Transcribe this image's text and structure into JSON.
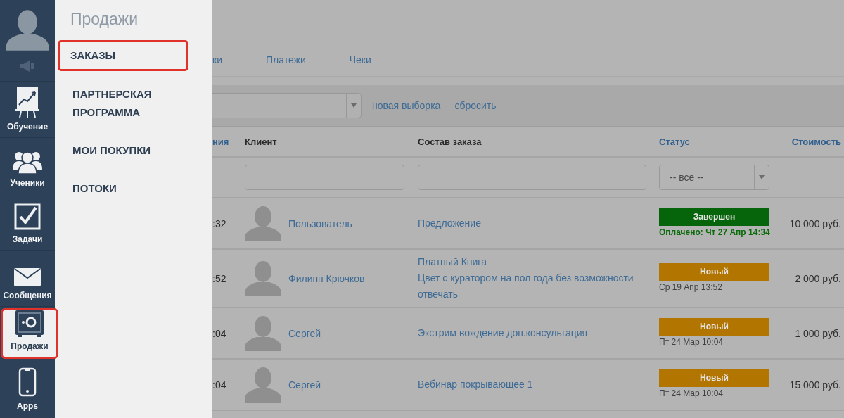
{
  "rail": {
    "items": [
      {
        "kind": "chart",
        "label": "Обучение",
        "selected": false,
        "highlighted": false
      },
      {
        "kind": "people",
        "label": "Ученики",
        "selected": false,
        "highlighted": false
      },
      {
        "kind": "task",
        "label": "Задачи",
        "selected": false,
        "highlighted": false
      },
      {
        "kind": "mail",
        "label": "Сообщения",
        "selected": false,
        "highlighted": false
      },
      {
        "kind": "safe",
        "label": "Продажи",
        "selected": true,
        "highlighted": true
      },
      {
        "kind": "phone",
        "label": "Apps",
        "selected": false,
        "highlighted": false
      }
    ]
  },
  "flyout": {
    "title": "Продажи",
    "items": [
      {
        "label": "ЗАКАЗЫ",
        "highlighted": true
      },
      {
        "label": "ПАРТНЕРСКАЯ ПРОГРАММА",
        "highlighted": false
      },
      {
        "label": "МОИ ПОКУПКИ",
        "highlighted": false
      },
      {
        "label": "ПОТОКИ",
        "highlighted": false
      }
    ]
  },
  "tabs": [
    {
      "label": "ки"
    },
    {
      "label": "Платежи"
    },
    {
      "label": "Чеки"
    }
  ],
  "filter_bar": {
    "links": [
      "новая выборка",
      "сбросить"
    ]
  },
  "table": {
    "columns": [
      {
        "label": "ния",
        "sortable": true
      },
      {
        "label": "Клиент",
        "sortable": false
      },
      {
        "label": "Состав заказа",
        "sortable": false
      },
      {
        "label": "Статус",
        "sortable": true
      },
      {
        "label": "Стоимость",
        "sortable": true
      }
    ],
    "status_filter": {
      "value": "-- все --"
    },
    "rows": [
      {
        "time": ":32",
        "client": "Пользователь",
        "items": [
          "Предложение"
        ],
        "status": {
          "kind": "completed",
          "label": "Завершен",
          "note": "Оплачено: Чт 27 Апр 14:34"
        },
        "price": "10 000 руб."
      },
      {
        "time": ":52",
        "client": "Филипп Крючков",
        "items": [
          "Платный Книга",
          "Цвет с куратором на пол года без возможности отвечать"
        ],
        "status": {
          "kind": "new",
          "label": "Новый",
          "note": "Ср 19 Апр 13:52"
        },
        "price": "2 000 руб."
      },
      {
        "time": ":04",
        "client": "Сергей",
        "items": [
          "Экстрим вождение доп.консультация"
        ],
        "status": {
          "kind": "new",
          "label": "Новый",
          "note": "Пт 24 Мар 10:04"
        },
        "price": "1 000 руб."
      },
      {
        "time": ":04",
        "client": "Сергей",
        "items": [
          "Вебинар покрывающее 1"
        ],
        "status": {
          "kind": "new",
          "label": "Новый",
          "note": "Пт 24 Мар 10:04"
        },
        "price": "15 000 руб."
      }
    ]
  }
}
